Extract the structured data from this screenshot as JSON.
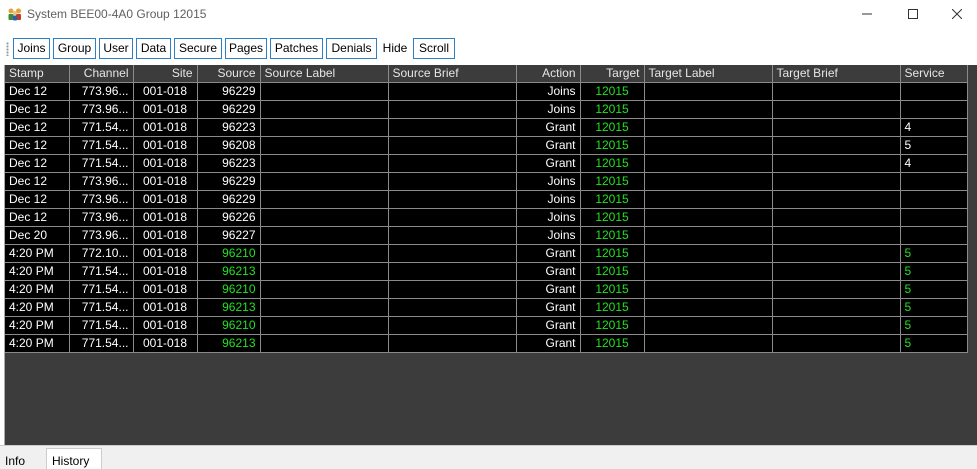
{
  "window": {
    "title": "System BEE00-4A0 Group 12015",
    "minimize_glyph": "—",
    "maximize_glyph": "☐",
    "close_glyph": "✕",
    "icon": "people-group-icon"
  },
  "toolbar": {
    "buttons": [
      "Joins",
      "Group",
      "User",
      "Data",
      "Secure",
      "Pages",
      "Patches",
      "Denials",
      "Hide",
      "Scroll"
    ]
  },
  "grid": {
    "columns": [
      "Stamp",
      "Channel",
      "Site",
      "Source",
      "Source Label",
      "Source Brief",
      "Action",
      "Target",
      "Target Label",
      "Target Brief",
      "Service"
    ],
    "rows": [
      {
        "stamp": "Dec 12",
        "channel": "773.96...",
        "site": "001-018",
        "source": "96229",
        "source_label": "",
        "source_brief": "",
        "action": "Joins",
        "target": "12015",
        "target_label": "",
        "target_brief": "",
        "service": ""
      },
      {
        "stamp": "Dec 12",
        "channel": "773.96...",
        "site": "001-018",
        "source": "96229",
        "source_label": "",
        "source_brief": "",
        "action": "Joins",
        "target": "12015",
        "target_label": "",
        "target_brief": "",
        "service": ""
      },
      {
        "stamp": "Dec 12",
        "channel": "771.54...",
        "site": "001-018",
        "source": "96223",
        "source_label": "",
        "source_brief": "",
        "action": "Grant",
        "target": "12015",
        "target_label": "",
        "target_brief": "",
        "service": "4"
      },
      {
        "stamp": "Dec 12",
        "channel": "771.54...",
        "site": "001-018",
        "source": "96208",
        "source_label": "",
        "source_brief": "",
        "action": "Grant",
        "target": "12015",
        "target_label": "",
        "target_brief": "",
        "service": "5"
      },
      {
        "stamp": "Dec 12",
        "channel": "771.54...",
        "site": "001-018",
        "source": "96223",
        "source_label": "",
        "source_brief": "",
        "action": "Grant",
        "target": "12015",
        "target_label": "",
        "target_brief": "",
        "service": "4"
      },
      {
        "stamp": "Dec 12",
        "channel": "773.96...",
        "site": "001-018",
        "source": "96229",
        "source_label": "",
        "source_brief": "",
        "action": "Joins",
        "target": "12015",
        "target_label": "",
        "target_brief": "",
        "service": ""
      },
      {
        "stamp": "Dec 12",
        "channel": "773.96...",
        "site": "001-018",
        "source": "96229",
        "source_label": "",
        "source_brief": "",
        "action": "Joins",
        "target": "12015",
        "target_label": "",
        "target_brief": "",
        "service": ""
      },
      {
        "stamp": "Dec 12",
        "channel": "773.96...",
        "site": "001-018",
        "source": "96226",
        "source_label": "",
        "source_brief": "",
        "action": "Joins",
        "target": "12015",
        "target_label": "",
        "target_brief": "",
        "service": ""
      },
      {
        "stamp": "Dec 20",
        "channel": "773.96...",
        "site": "001-018",
        "source": "96227",
        "source_label": "",
        "source_brief": "",
        "action": "Joins",
        "target": "12015",
        "target_label": "",
        "target_brief": "",
        "service": ""
      },
      {
        "stamp": "4:20 PM",
        "channel": "772.10...",
        "site": "001-018",
        "source": "96210",
        "source_label": "",
        "source_brief": "",
        "action": "Grant",
        "target": "12015",
        "target_label": "",
        "target_brief": "",
        "service": "5",
        "live": true
      },
      {
        "stamp": "4:20 PM",
        "channel": "771.54...",
        "site": "001-018",
        "source": "96213",
        "source_label": "",
        "source_brief": "",
        "action": "Grant",
        "target": "12015",
        "target_label": "",
        "target_brief": "",
        "service": "5",
        "live": true
      },
      {
        "stamp": "4:20 PM",
        "channel": "771.54...",
        "site": "001-018",
        "source": "96210",
        "source_label": "",
        "source_brief": "",
        "action": "Grant",
        "target": "12015",
        "target_label": "",
        "target_brief": "",
        "service": "5",
        "live": true
      },
      {
        "stamp": "4:20 PM",
        "channel": "771.54...",
        "site": "001-018",
        "source": "96213",
        "source_label": "",
        "source_brief": "",
        "action": "Grant",
        "target": "12015",
        "target_label": "",
        "target_brief": "",
        "service": "5",
        "live": true
      },
      {
        "stamp": "4:20 PM",
        "channel": "771.54...",
        "site": "001-018",
        "source": "96210",
        "source_label": "",
        "source_brief": "",
        "action": "Grant",
        "target": "12015",
        "target_label": "",
        "target_brief": "",
        "service": "5",
        "live": true
      },
      {
        "stamp": "4:20 PM",
        "channel": "771.54...",
        "site": "001-018",
        "source": "96213",
        "source_label": "",
        "source_brief": "",
        "action": "Grant",
        "target": "12015",
        "target_label": "",
        "target_brief": "",
        "service": "5",
        "live": true
      }
    ]
  },
  "tabs": [
    "Info",
    "History"
  ],
  "colors": {
    "grid_background": "#3c3c3c",
    "cell_background": "#000000",
    "cell_text": "#ffffff",
    "highlight_green": "#22e022",
    "button_border": "#2f7fc4"
  }
}
